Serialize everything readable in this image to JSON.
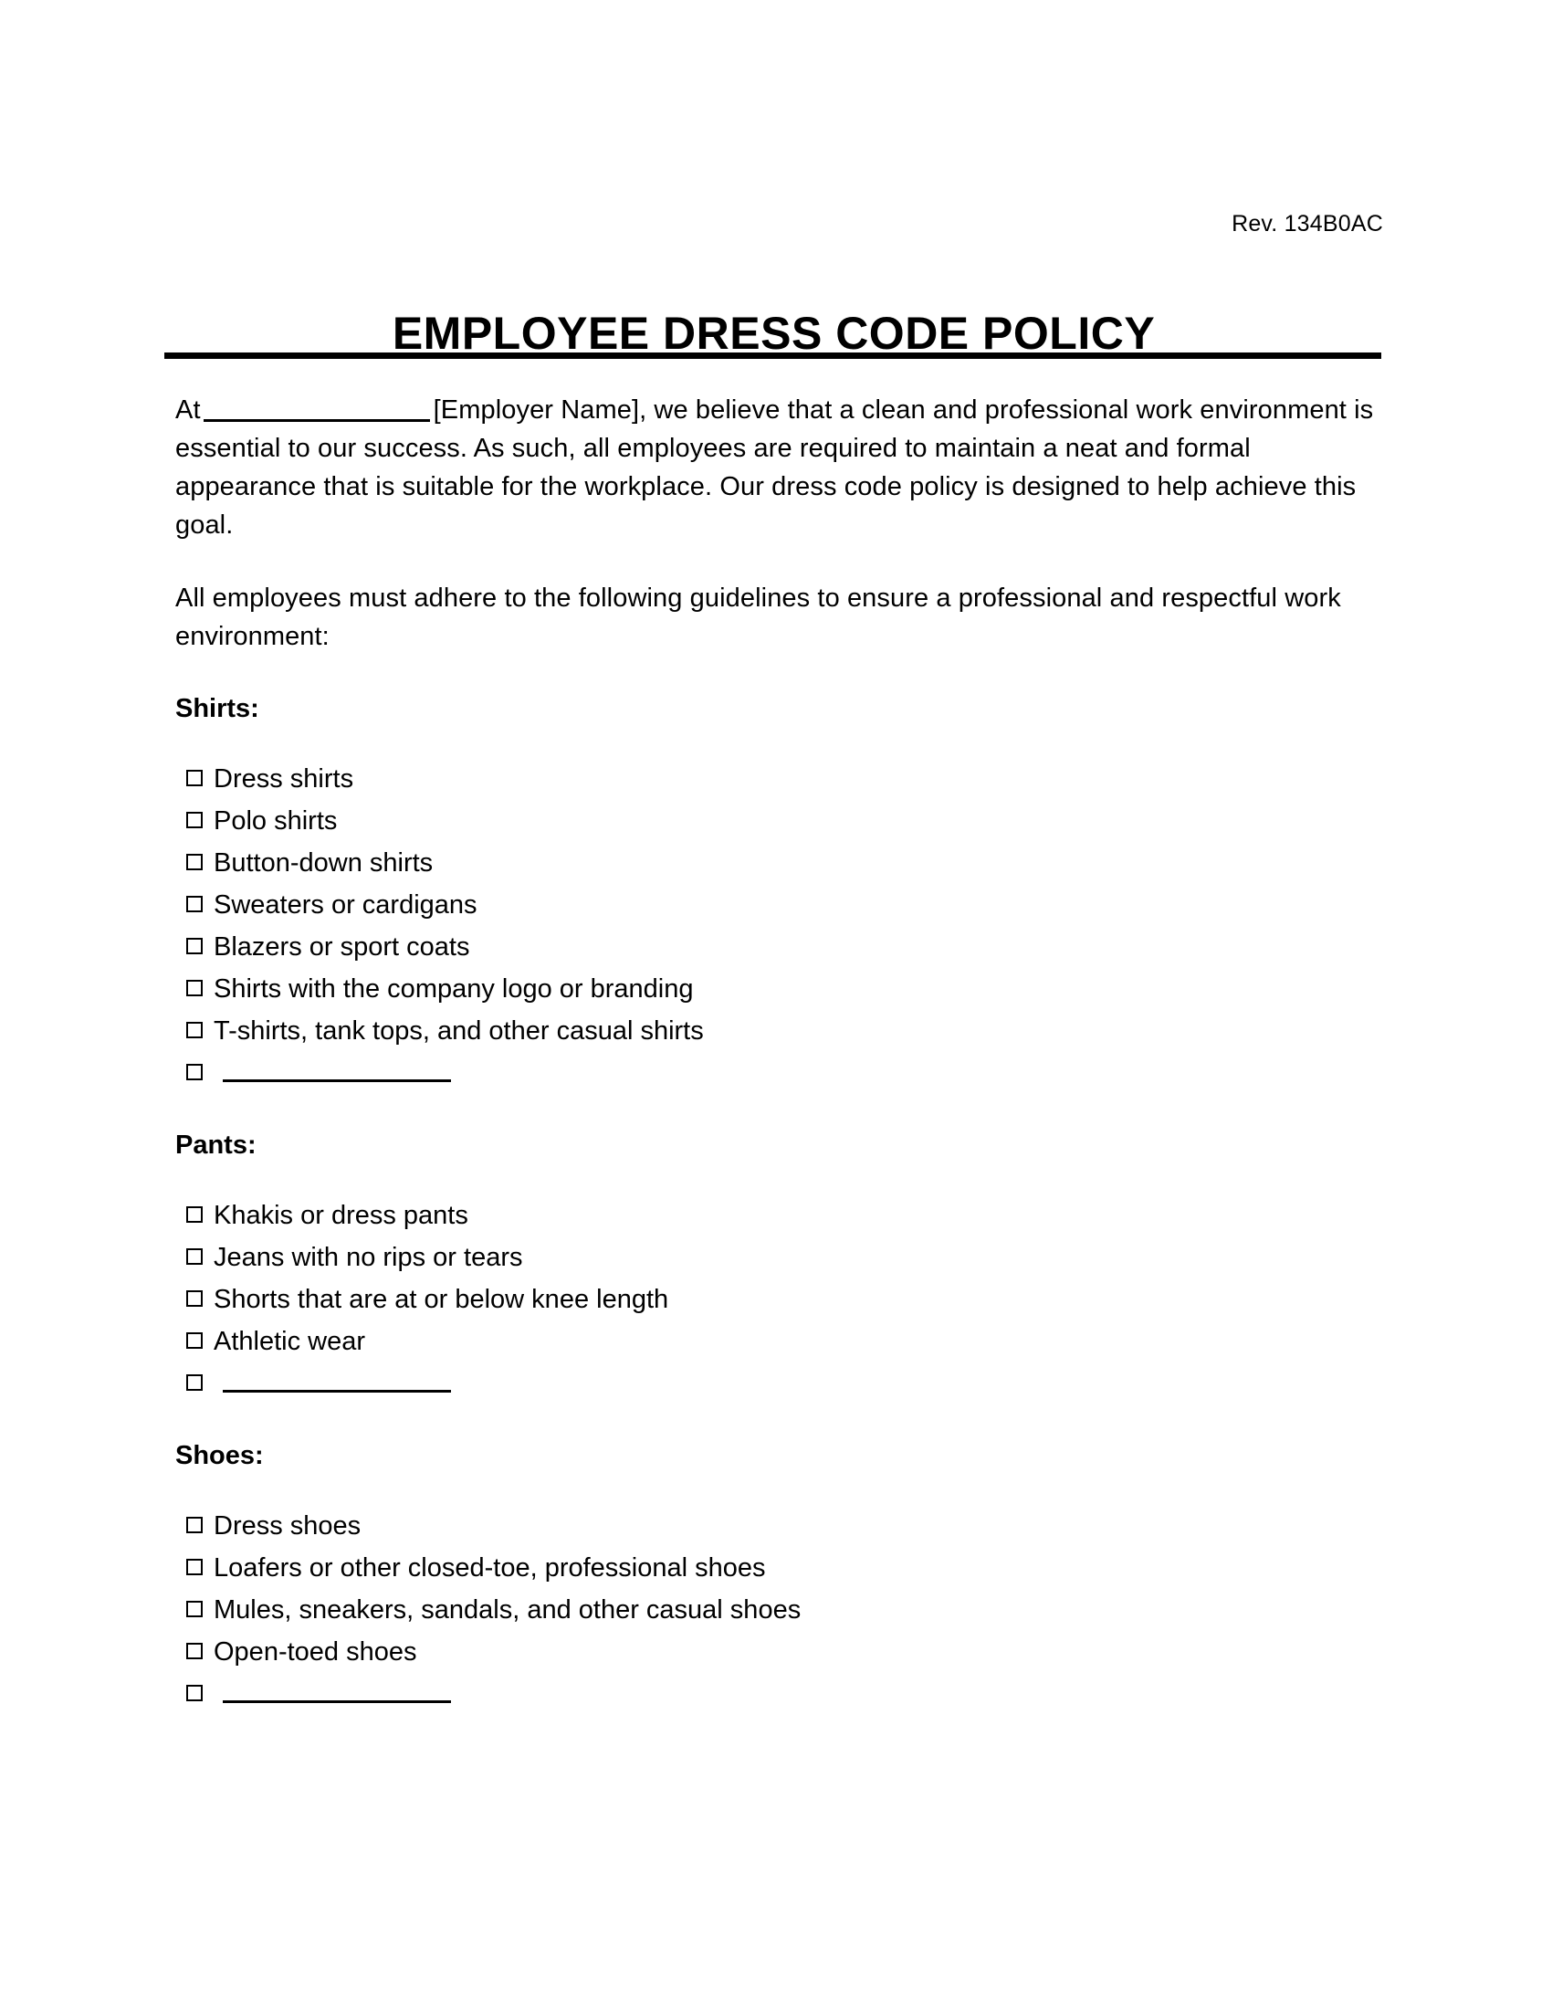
{
  "document": {
    "revision": "Rev. 134B0AC",
    "title": "EMPLOYEE DRESS CODE POLICY",
    "intro_paragraph_1_before_blank": "At",
    "intro_paragraph_1_after_blank": "[Employer Name], we believe that a clean and professional work environment is essential to our success. As such, all employees are required to maintain a neat and formal appearance that is suitable for the workplace. Our dress code policy is designed to help achieve this goal.",
    "intro_paragraph_2": "All employees must adhere to the following guidelines to ensure a professional and respectful work environment:"
  },
  "sections": [
    {
      "heading": "Shirts:",
      "items": [
        "Dress shirts",
        "Polo shirts",
        "Button-down shirts",
        "Sweaters or cardigans",
        "Blazers or sport coats",
        "Shirts with the company logo or branding",
        "T-shirts, tank tops, and other casual shirts"
      ],
      "has_blank_item": true
    },
    {
      "heading": "Pants:",
      "items": [
        "Khakis or dress pants",
        "Jeans with no rips or tears",
        "Shorts that are at or below knee length",
        "Athletic wear"
      ],
      "has_blank_item": true
    },
    {
      "heading": "Shoes:",
      "items": [
        "Dress shoes",
        "Loafers or other closed-toe, professional shoes",
        "Mules, sneakers, sandals, and other casual shoes",
        "Open-toed shoes"
      ],
      "has_blank_item": true
    }
  ]
}
